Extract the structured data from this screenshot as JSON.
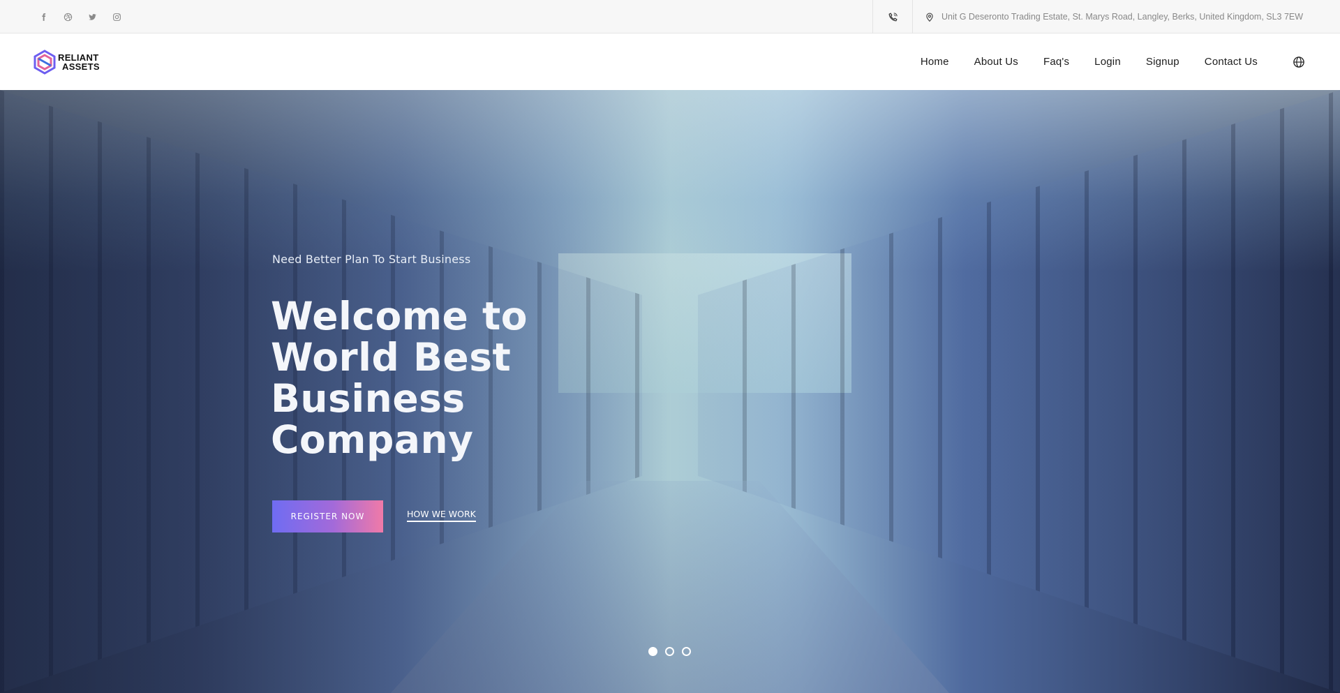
{
  "topbar": {
    "social_icons": [
      "facebook-icon",
      "dribbble-icon",
      "twitter-icon",
      "instagram-icon"
    ],
    "phone_icon": "phone-icon",
    "address_icon": "map-pin-icon",
    "address": "Unit G Deseronto Trading Estate, St. Marys Road, Langley, Berks, United Kingdom, SL3 7EW"
  },
  "header": {
    "logo_line1": "RELIANT",
    "logo_line2": "ASSETS",
    "nav": [
      "Home",
      "About Us",
      "Faq's",
      "Login",
      "Signup",
      "Contact Us"
    ],
    "language_icon": "globe-icon"
  },
  "hero": {
    "subtitle": "Need Better Plan To Start Business",
    "title": "Welcome to World Best Business Company",
    "register_label": "REGISTER NOW",
    "how_label": "HOW WE WORK",
    "slides_total": 3,
    "active_slide": 1
  },
  "colors": {
    "button_gradient_start": "#6f6cf2",
    "button_gradient_end": "#f07aa8",
    "topbar_bg": "#f7f7f7"
  }
}
